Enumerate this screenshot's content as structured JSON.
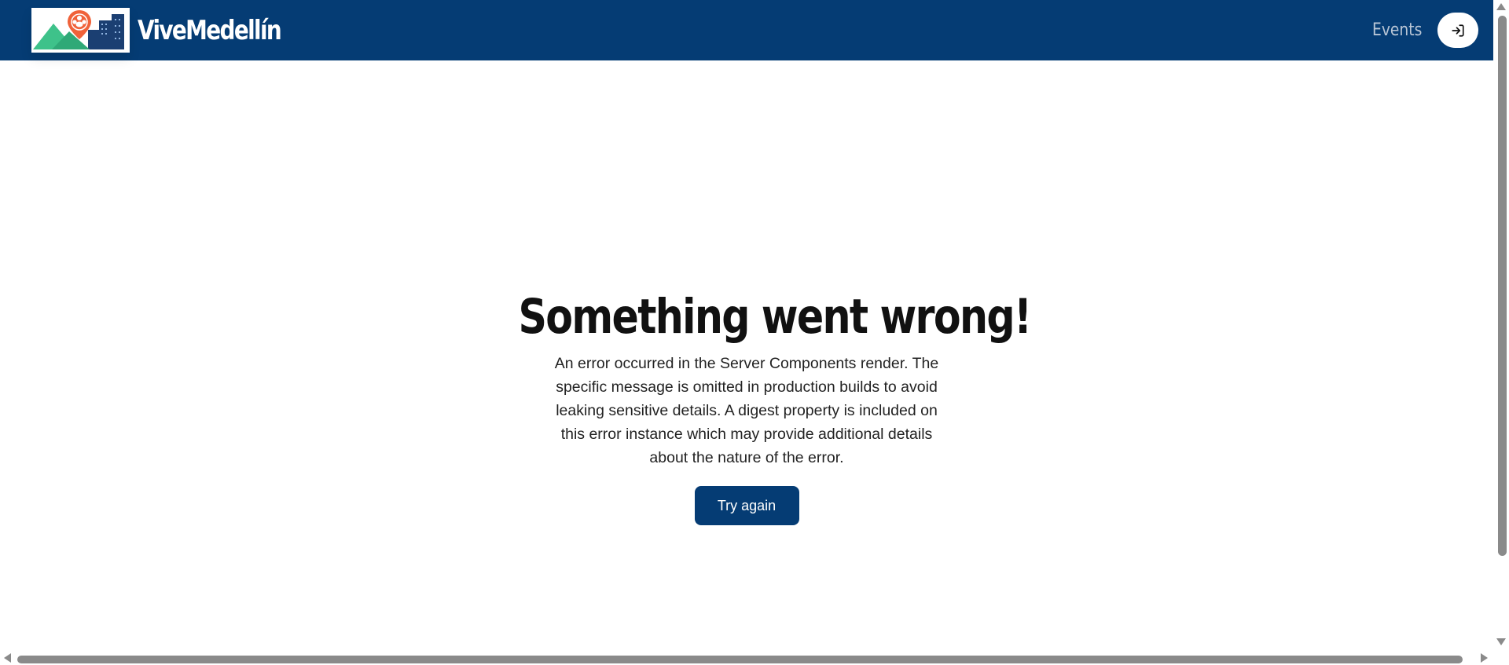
{
  "header": {
    "brand_name": "ViveMedellín",
    "nav": {
      "events_label": "Events"
    },
    "login_icon": "sign-in-arrow-icon",
    "logo_icon": "vive-medellin-logo-icon",
    "background_color": "#053c74"
  },
  "error": {
    "title": "Something went wrong!",
    "message": "An error occurred in the Server Components render. The specific message is omitted in production builds to avoid leaking sensitive details. A digest property is included on this error instance which may provide additional details about the nature of the error.",
    "retry_label": "Try again"
  },
  "colors": {
    "primary": "#053c74",
    "logo_green": "#3ec28a",
    "logo_orange": "#f0623a",
    "scrollbar": "#8a8a8a"
  }
}
